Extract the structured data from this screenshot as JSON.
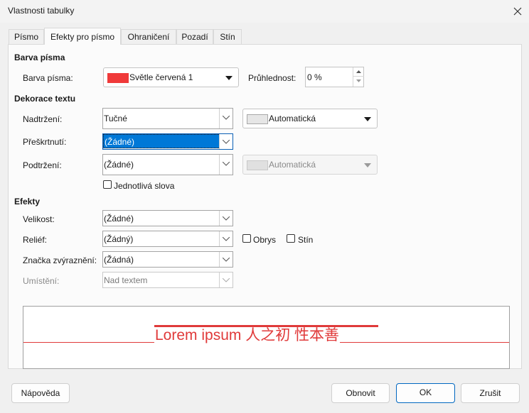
{
  "window": {
    "title": "Vlastnosti tabulky",
    "close_icon": "close-icon"
  },
  "tabs": [
    {
      "label": "Písmo",
      "active": false
    },
    {
      "label": "Efekty pro písmo",
      "active": true
    },
    {
      "label": "Ohraničení",
      "active": false
    },
    {
      "label": "Pozadí",
      "active": false
    },
    {
      "label": "Stín",
      "active": false
    }
  ],
  "font_color": {
    "heading": "Barva písma",
    "label": "Barva písma:",
    "value": "Světle červená 1",
    "swatch_color": "#f03a3a",
    "transparency_label": "Průhlednost:",
    "transparency_value": "0 %"
  },
  "decoration": {
    "heading": "Dekorace textu",
    "overline_label": "Nadtržení:",
    "overline_value": "Tučné",
    "overline_color": "Automatická",
    "strikethrough_label": "Přeškrtnutí:",
    "strikethrough_value": "(Žádné)",
    "underline_label": "Podtržení:",
    "underline_value": "(Žádné)",
    "underline_color": "Automatická",
    "individual_words_label": "Jednotlivá slova"
  },
  "effects": {
    "heading": "Efekty",
    "case_label": "Velikost:",
    "case_value": "(Žádné)",
    "relief_label": "Reliéf:",
    "relief_value": "(Žádný)",
    "outline_label": "Obrys",
    "shadow_label": "Stín",
    "emphasis_label": "Značka zvýraznění:",
    "emphasis_value": "(Žádná)",
    "position_label": "Umístění:",
    "position_value": "Nad textem"
  },
  "preview": {
    "text": "Lorem ipsum   人之初 性本善",
    "text_color": "#e03a3a"
  },
  "buttons": {
    "help": "Nápověda",
    "reset": "Obnovit",
    "ok": "OK",
    "cancel": "Zrušit"
  },
  "colors": {
    "accent": "#0078d7",
    "swatch_grey": "#e6e6e6"
  }
}
